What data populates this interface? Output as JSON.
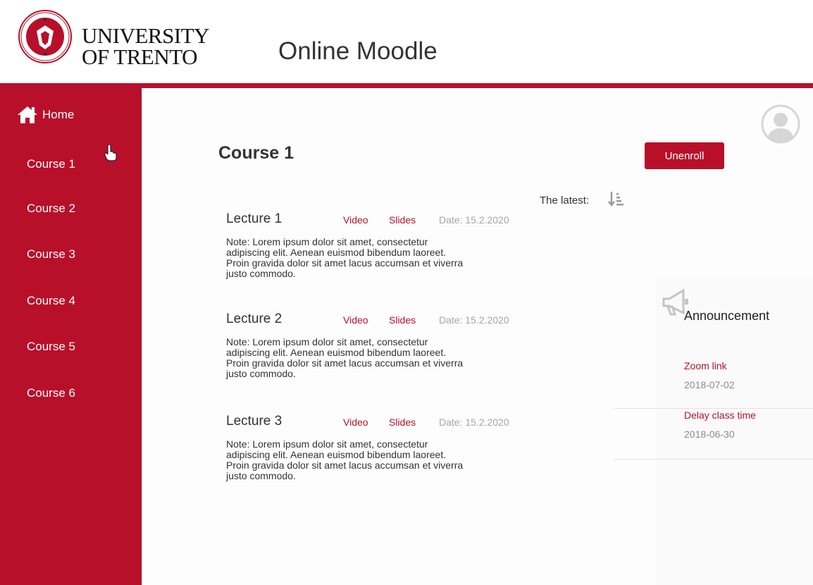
{
  "header": {
    "logo_line1": "UNIVERSITY",
    "logo_line2": "OF TRENTO",
    "app_title": "Online Moodle"
  },
  "sidebar": {
    "home_label": "Home",
    "courses": [
      "Course 1",
      "Course 2",
      "Course 3",
      "Course 4",
      "Course 5",
      "Course 6"
    ]
  },
  "main": {
    "course_title": "Course 1",
    "unenroll_label": "Unenroll",
    "sort_label": "The latest:",
    "lectures": [
      {
        "title": "Lecture 1",
        "video": "Video",
        "slides": "Slides",
        "date": "Date: 15.2.2020",
        "note": "Note: Lorem ipsum dolor sit amet, consectetur adipiscing elit. Aenean euismod bibendum laoreet. Proin gravida dolor sit amet lacus accumsan et viverra justo commodo."
      },
      {
        "title": "Lecture 2",
        "video": "Video",
        "slides": "Slides",
        "date": "Date: 15.2.2020",
        "note": "Note: Lorem ipsum dolor sit amet, consectetur adipiscing elit. Aenean euismod bibendum laoreet. Proin gravida dolor sit amet lacus accumsan et viverra justo commodo."
      },
      {
        "title": "Lecture 3",
        "video": "Video",
        "slides": "Slides",
        "date": "Date: 15.2.2020",
        "note": "Note: Lorem ipsum dolor sit amet, consectetur adipiscing elit. Aenean euismod bibendum laoreet. Proin gravida dolor sit amet lacus accumsan et viverra justo commodo."
      }
    ]
  },
  "announcements": {
    "title": "Announcement",
    "items": [
      {
        "label": "Zoom link",
        "date": "2018-07-02"
      },
      {
        "label": "Delay class time",
        "date": "2018-06-30"
      }
    ]
  },
  "colors": {
    "brand": "#b8102a",
    "muted_text": "#a6a6a6"
  },
  "icons": [
    "home-icon",
    "user-avatar-icon",
    "sort-descending-icon",
    "megaphone-icon",
    "university-seal-icon",
    "hand-cursor-icon"
  ]
}
